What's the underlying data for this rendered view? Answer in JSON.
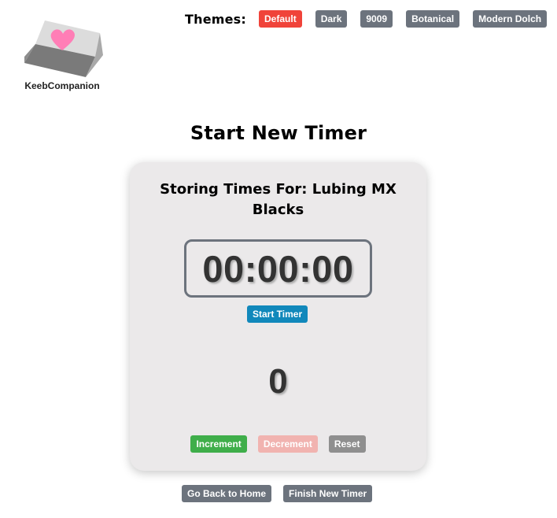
{
  "logo": {
    "text": "KeebCompanion",
    "icon": "keycap-heart-icon"
  },
  "themes": {
    "label": "Themes:",
    "options": [
      {
        "label": "Default",
        "active": true,
        "color": "#f0433a"
      },
      {
        "label": "Dark",
        "active": false,
        "color": "#6c737d"
      },
      {
        "label": "9009",
        "active": false,
        "color": "#6c737d"
      },
      {
        "label": "Botanical",
        "active": false,
        "color": "#6c737d"
      },
      {
        "label": "Modern Dolch",
        "active": false,
        "color": "#6c737d"
      }
    ]
  },
  "page": {
    "title": "Start New Timer"
  },
  "card": {
    "title": "Storing Times For: Lubing MX Blacks",
    "timer": "00:00:00",
    "start_label": "Start Timer",
    "counter": "0",
    "increment_label": "Increment",
    "decrement_label": "Decrement",
    "reset_label": "Reset"
  },
  "footer": {
    "back_label": "Go Back to Home",
    "finish_label": "Finish New Timer"
  }
}
